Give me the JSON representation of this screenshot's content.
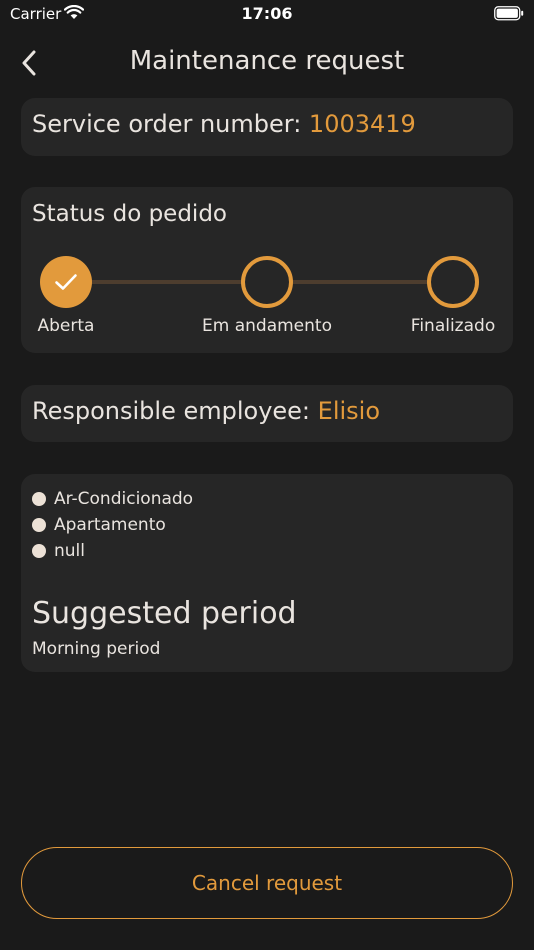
{
  "status_bar": {
    "carrier": "Carrier",
    "time": "17:06",
    "wifi_icon": "wifi-icon",
    "battery_icon": "battery-icon"
  },
  "nav": {
    "title": "Maintenance request",
    "back_icon": "chevron-left-icon"
  },
  "order": {
    "label": "Service order number: ",
    "number": "1003419"
  },
  "status": {
    "title": "Status do pedido",
    "steps": [
      {
        "label": "Aberta",
        "state": "done",
        "icon": "checkmark-icon"
      },
      {
        "label": "Em andamento",
        "state": "pending"
      },
      {
        "label": "Finalizado",
        "state": "pending"
      }
    ]
  },
  "employee": {
    "label": "Responsible employee: ",
    "name": "Elisio"
  },
  "details": {
    "items": [
      "Ar-Condicionado",
      "Apartamento",
      "null"
    ],
    "period_title": "Suggested period",
    "period_value": "Morning period"
  },
  "actions": {
    "cancel_label": "Cancel request"
  },
  "colors": {
    "background": "#1a1a1a",
    "card": "#262626",
    "accent": "#e29a3c",
    "text": "#e9e4df"
  }
}
